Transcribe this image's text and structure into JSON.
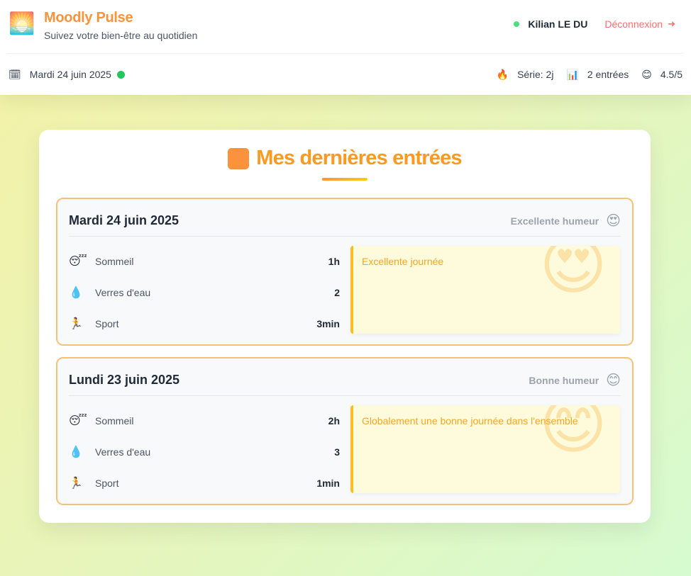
{
  "app": {
    "name": "Moodly Pulse",
    "tagline": "Suivez votre bien-être au quotidien",
    "logo_icon": "🌅"
  },
  "user": {
    "name": "Kilian LE DU",
    "logout_label": "Déconnexion",
    "logout_icon": "➜",
    "online_color": "#4ade80"
  },
  "today": {
    "icon": "🗓",
    "date": "Mardi 24 juin 2025",
    "status_color": "#22c55e"
  },
  "stats": {
    "streak_icon": "🔥",
    "streak": "Série: 2j",
    "entries_icon": "📊",
    "entries": "2 entrées",
    "mood_icon": "😊",
    "mood_avg": "4.5/5"
  },
  "section": {
    "title": "Mes dernières entrées",
    "accent_color": "#fb923c"
  },
  "entries": [
    {
      "date": "Mardi 24 juin 2025",
      "mood_label": "Excellente humeur",
      "mood_emoji": "😍",
      "metrics": [
        {
          "icon": "😴",
          "label": "Sommeil",
          "value": "1h"
        },
        {
          "icon": "💧",
          "label": "Verres d'eau",
          "value": "2"
        },
        {
          "icon": "🏃",
          "label": "Sport",
          "value": "3min"
        }
      ],
      "note": "Excellente journée"
    },
    {
      "date": "Lundi 23 juin 2025",
      "mood_label": "Bonne humeur",
      "mood_emoji": "😊",
      "metrics": [
        {
          "icon": "😴",
          "label": "Sommeil",
          "value": "2h"
        },
        {
          "icon": "💧",
          "label": "Verres d'eau",
          "value": "3"
        },
        {
          "icon": "🏃",
          "label": "Sport",
          "value": "1min"
        }
      ],
      "note": "Globalement une bonne journée dans l'ensemble"
    }
  ]
}
